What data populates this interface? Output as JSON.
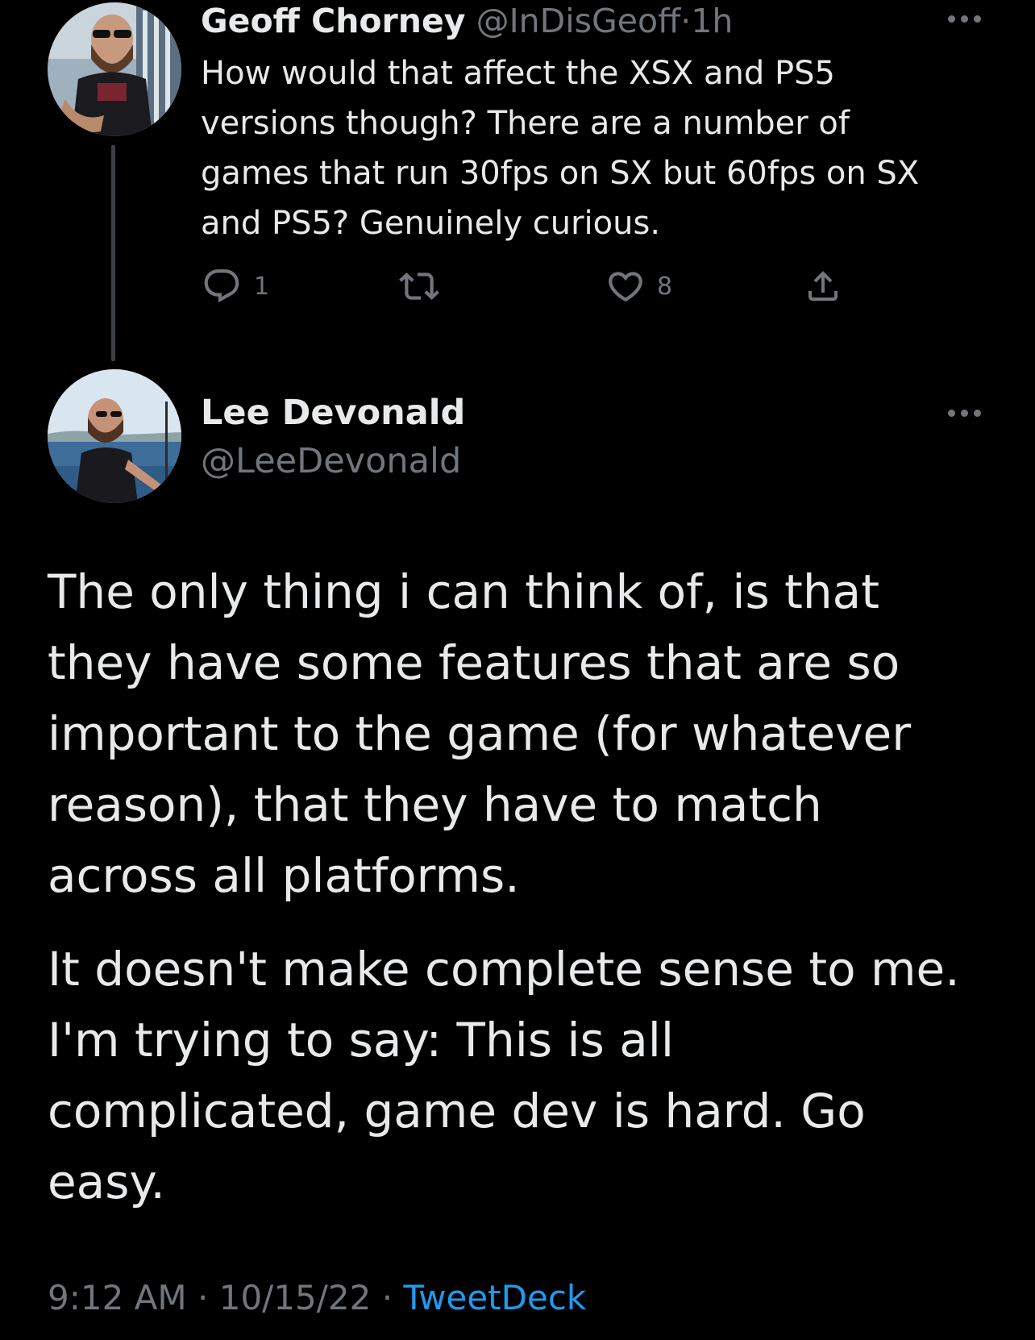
{
  "parent_tweet": {
    "author_name": "Geoff Chorney",
    "handle": "@InDisGeoff",
    "separator": "·",
    "time_ago": "1h",
    "text": "How would that affect the XSX and PS5\nversions though? There are a number of\ngames that run 30fps on SX but 60fps on SX\nand PS5? Genuinely curious.",
    "reply_count": "1",
    "retweet_count": "",
    "like_count": "8",
    "icons": [
      "reply-icon",
      "retweet-icon",
      "like-icon",
      "share-icon",
      "more-icon"
    ]
  },
  "main_tweet": {
    "author_name": "Lee Devonald",
    "handle": "@LeeDevonald",
    "paragraphs": [
      "The only thing i can think of, is that\nthey have some features that are so\nimportant to the game (for whatever\nreason), that they have to match\nacross all platforms.",
      "It doesn't make complete sense to me.\nI'm trying to say: This is all\ncomplicated, game dev is hard. Go\neasy."
    ],
    "time": "9:12 AM",
    "separator": "·",
    "date": "10/15/22",
    "source": "TweetDeck"
  },
  "colors": {
    "background": "#000000",
    "text_primary": "#e7e9ea",
    "text_muted": "#71767b",
    "accent": "#1d9bf0",
    "thread_line": "#3e4144"
  }
}
